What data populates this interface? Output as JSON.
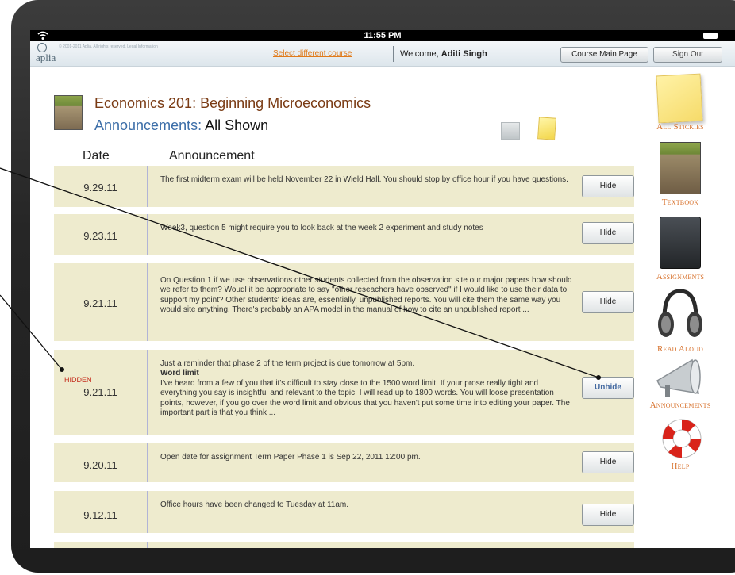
{
  "status_bar": {
    "time": "11:55 PM"
  },
  "header": {
    "logo": "aplia",
    "copyright": "© 2001-2011 Aplia. All rights reserved. Legal Information",
    "select_course": "Select different course",
    "welcome_prefix": "Welcome,",
    "user_name": "Aditi Singh",
    "course_main_button": "Course Main Page",
    "sign_out_button": "Sign Out"
  },
  "page": {
    "course_title": "Economics 201: Beginning Microeconomics",
    "section_label": "Announcements:",
    "section_filter": "All Shown"
  },
  "table": {
    "columns": [
      "Date",
      "Announcement"
    ],
    "rows": [
      {
        "date": "9.29.11",
        "text": "The first midterm exam will be held November 22 in Wield Hall. You should stop by office hour if you have questions.",
        "button": "Hide"
      },
      {
        "date": "9.23.11",
        "text": "Week3, question 5 might require you to look back at the week 2 experiment and study notes",
        "button": "Hide"
      },
      {
        "date": "9.21.11",
        "text": "On Question 1 if we use observations other students collected from the observation site our major papers how should we refer to them? Woudl it be appropriate to say \"other reseachers have observed\" if I would like to use their data to support my point? Other students' ideas are, essentially, unpublished reports. You will cite them the same way you would site anything. There's probably an APA model in the manual of how to cite an unpublished report ...",
        "button": "Hide"
      },
      {
        "date": "9.21.11",
        "hidden_label": "HIDDEN",
        "text_intro": "Just a reminder that phase 2 of the term project is due tomorrow at 5pm.",
        "subtitle": "Word limit",
        "text": "I've heard from a few of you that it's difficult to stay close to the 1500 word limit. If your prose really tight and everything you say is insightful and relevant to the topic, I will read up to 1800 words. You will loose presentation points, however, if you go over the word limit and obvious that you haven't put some time into editing your paper. The important part is that you think ...",
        "button": "Unhide"
      },
      {
        "date": "9.20.11",
        "text": "Open date for assignment Term Paper Phase 1 is Sep 22, 2011 12:00 pm.",
        "button": "Hide"
      },
      {
        "date": "9.12.11",
        "text": "Office hours have been changed to Tuesday at 11am.",
        "button": "Hide"
      }
    ]
  },
  "sidebar": {
    "items": [
      {
        "label": "All Stickies",
        "icon": "sticky-note-icon"
      },
      {
        "label": "Textbook",
        "icon": "textbook-icon"
      },
      {
        "label": "Assignments",
        "icon": "assignments-icon"
      },
      {
        "label": "Read Aloud",
        "icon": "headphones-icon"
      },
      {
        "label": "Announcements",
        "icon": "megaphone-icon"
      },
      {
        "label": "Help",
        "icon": "life-ring-icon"
      }
    ]
  },
  "colors": {
    "row_bg": "#eeebce",
    "title_brown": "#7a3b14",
    "title_blue": "#3c6ea8",
    "sidebar_orange": "#d7702a",
    "hidden_red": "#c42a1a"
  }
}
